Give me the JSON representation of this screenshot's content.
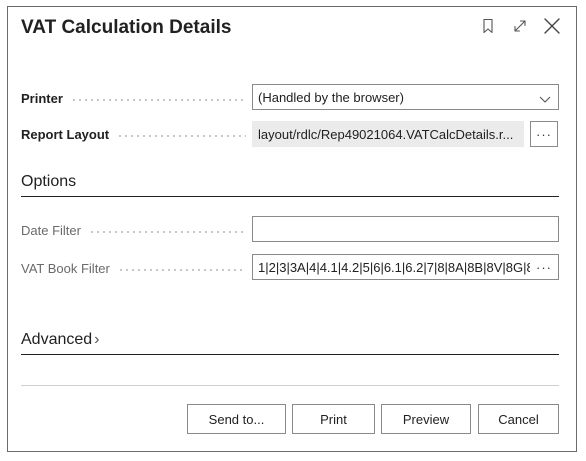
{
  "dialog": {
    "title": "VAT Calculation Details",
    "icons": [
      "bookmark-icon",
      "expand-icon",
      "close-icon"
    ]
  },
  "fields": {
    "printer": {
      "label": "Printer",
      "value": "(Handled by the browser)"
    },
    "report_layout": {
      "label": "Report Layout",
      "value": "layout/rdlc/Rep49021064.VATCalcDetails.r...",
      "ellipsis": "···"
    }
  },
  "options": {
    "title": "Options",
    "date_filter": {
      "label": "Date Filter",
      "value": ""
    },
    "vat_book_filter": {
      "label": "VAT Book Filter",
      "value": "1|2|3|3A|4|4.1|4.2|5|6|6.1|6.2|7|8|8A|8B|8V|8G|8",
      "ellipsis": "···"
    }
  },
  "advanced": {
    "title": "Advanced",
    "chevron": "›"
  },
  "buttons": {
    "send_to": "Send to...",
    "print": "Print",
    "preview": "Preview",
    "cancel": "Cancel"
  },
  "colors": {
    "border": "#8a8a8a",
    "readonly_bg": "#ebebeb",
    "text": "#212121",
    "muted_label": "#6a6a6a"
  }
}
